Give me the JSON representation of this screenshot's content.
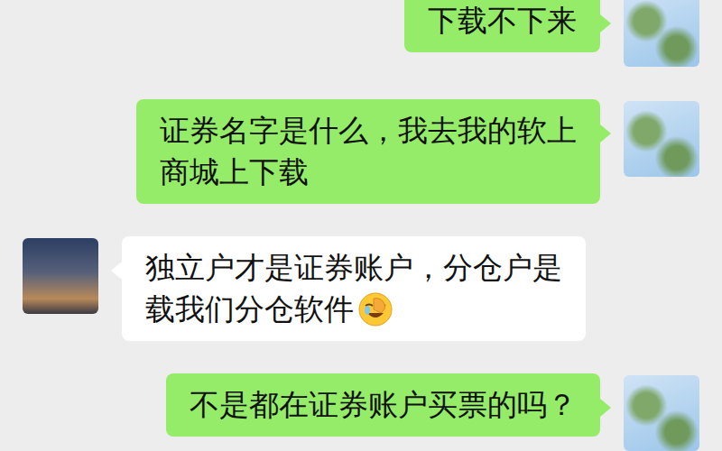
{
  "messages": [
    {
      "side": "right",
      "lines": [
        "下载不下来"
      ],
      "emoji": false
    },
    {
      "side": "right",
      "lines": [
        "证券名字是什么，我去我的软上",
        "商城上下载"
      ],
      "emoji": false
    },
    {
      "side": "left",
      "lines": [
        "独立户才是证券账户，分仓户是",
        "载我们分仓软件"
      ],
      "emoji": true
    },
    {
      "side": "right",
      "lines": [
        "不是都在证券账户买票的吗？"
      ],
      "emoji": false
    }
  ]
}
